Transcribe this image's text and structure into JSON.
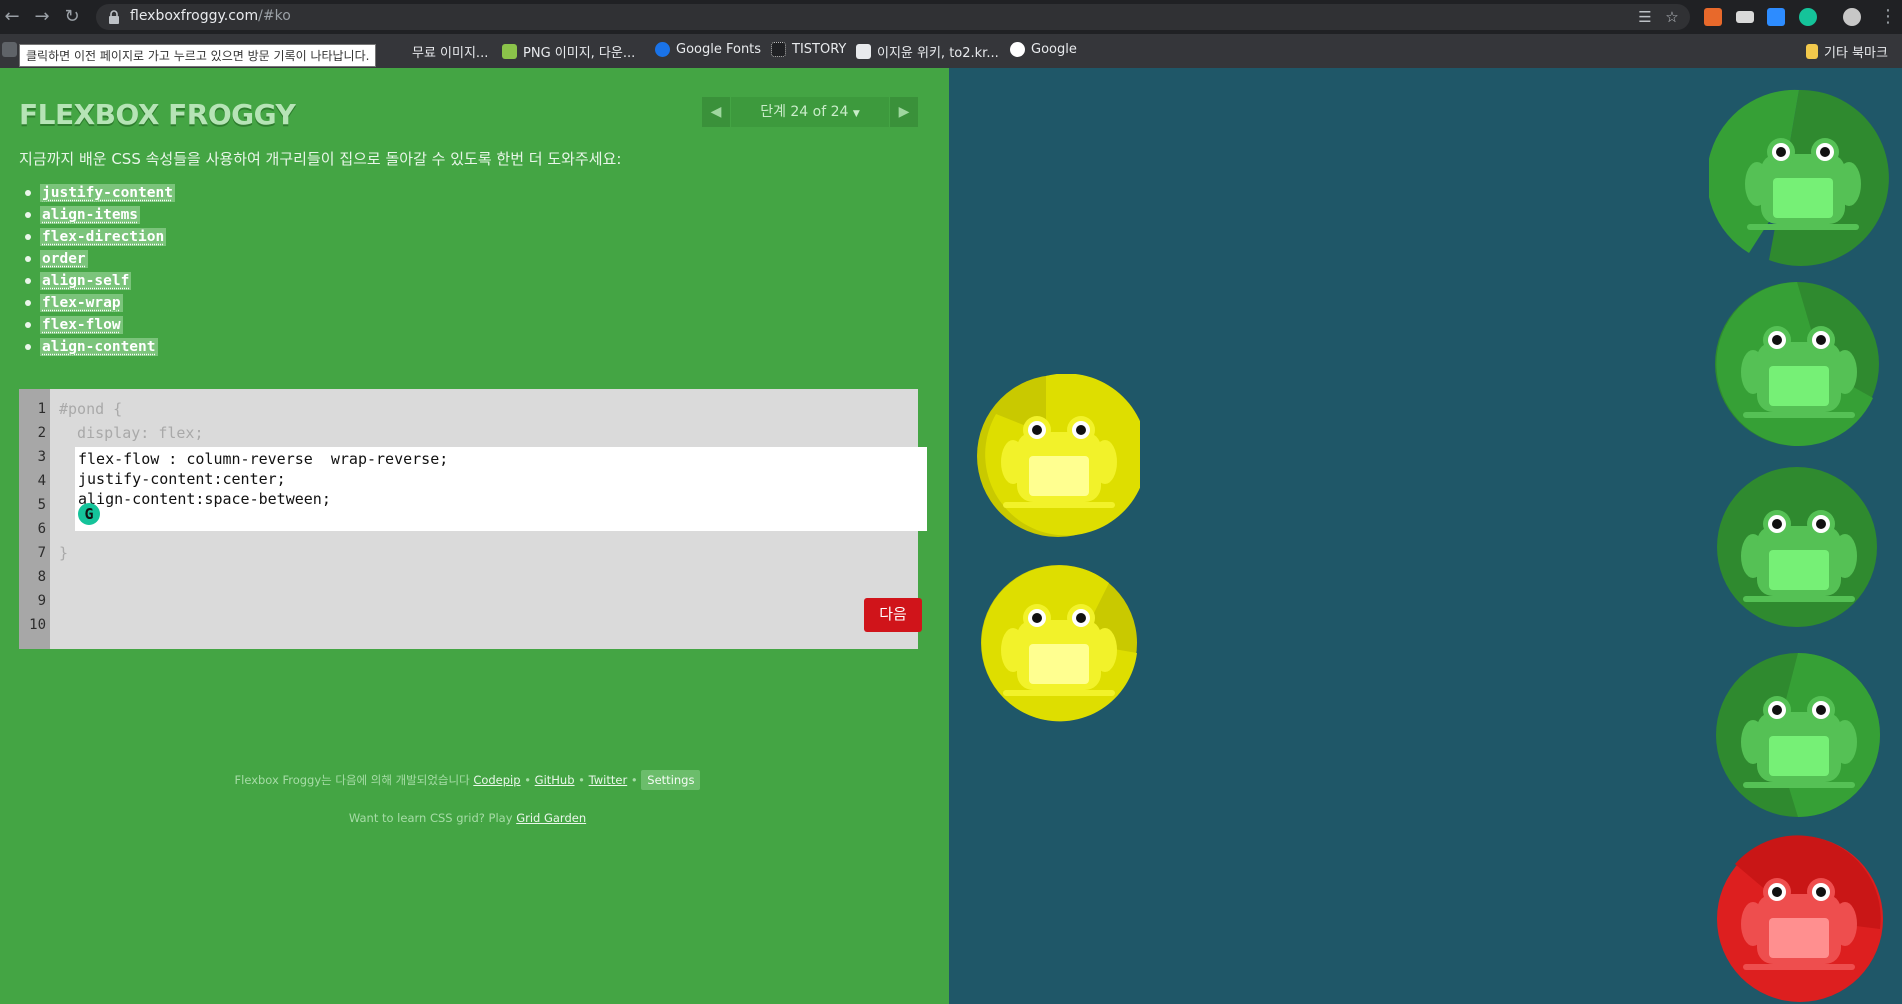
{
  "browser": {
    "url_host": "flexboxfroggy.com",
    "url_path": "/#ko",
    "tooltip": "클릭하면 이전 페이지로 가고 누르고 있으면 방문 기록이 나타납니다.",
    "bookmarks": [
      "무료 이미지...",
      "PNG 이미지, 다운...",
      "Google Fonts",
      "TISTORY",
      "이지윤 위키, to2.kr...",
      "Google"
    ],
    "other_bookmarks": "기타 북마크"
  },
  "game": {
    "logo": "FLEXBOX FROGGY",
    "level_label": "단계 24 of 24",
    "instructions": "지금까지 배운 CSS 속성들을 사용하여 개구리들이 집으로 돌아갈 수 있도록 한번 더 도와주세요:",
    "properties": [
      "justify-content",
      "align-items",
      "flex-direction",
      "order",
      "align-self",
      "flex-wrap",
      "flex-flow",
      "align-content"
    ]
  },
  "editor": {
    "line_numbers": [
      "1",
      "2",
      "3",
      "4",
      "5",
      "6",
      "7",
      "8",
      "9",
      "10"
    ],
    "line1": "#pond {",
    "line2": "  display: flex;",
    "line7": "}",
    "input_lines": [
      "flex-flow : column-reverse  wrap-reverse;",
      "justify-content:center;",
      "align-content:space-between;"
    ],
    "next_label": "다음"
  },
  "footer": {
    "credit_prefix": "Flexbox Froggy는 다음에 의해 개발되었습니다",
    "codepip": "Codepip",
    "github": "GitHub",
    "twitter": "Twitter",
    "settings": "Settings",
    "grid_prefix": "Want to learn CSS grid? Play",
    "grid_link": "Grid Garden"
  },
  "pond": {
    "colors": {
      "green": "#36a036",
      "yellow": "#d8d800",
      "red": "#dd1f1f",
      "water": "#1f5768"
    }
  }
}
